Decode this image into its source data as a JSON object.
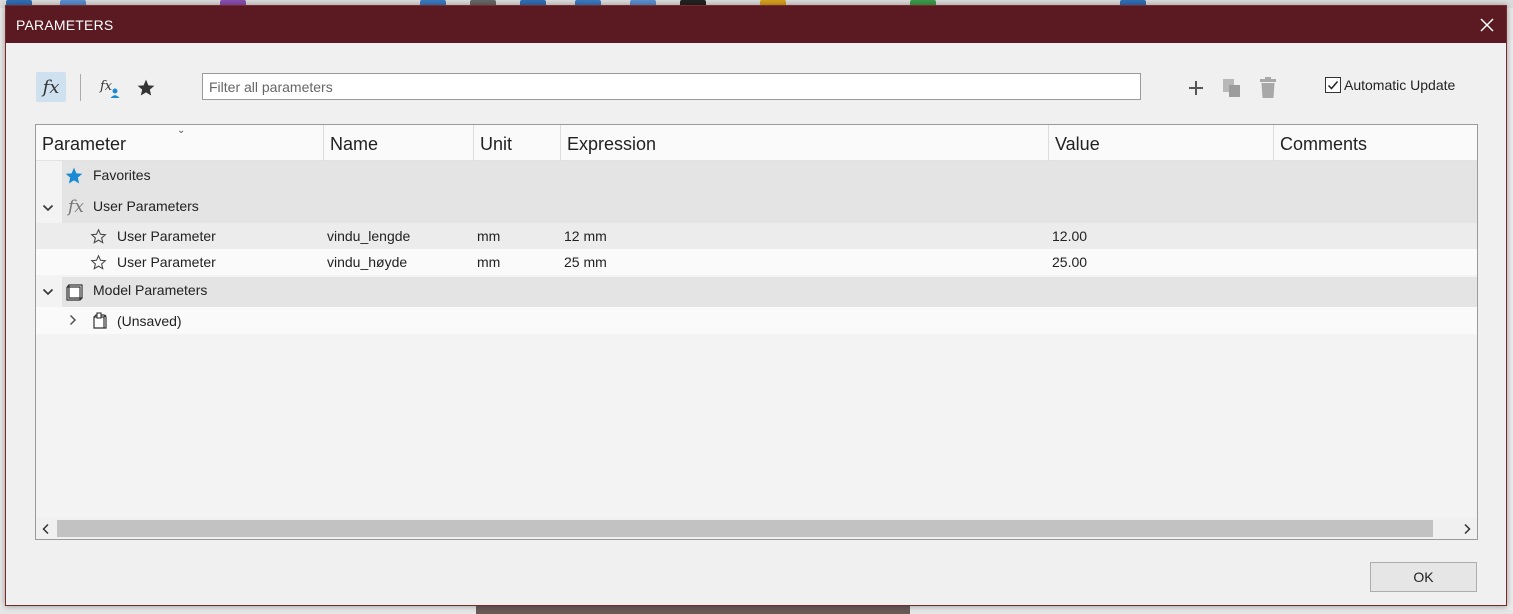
{
  "dialog": {
    "title": "PARAMETERS",
    "close_icon": "close-icon"
  },
  "toolbar": {
    "fx_icon": "fx",
    "filter_placeholder": "Filter all parameters",
    "filter_value": "",
    "auto_update_label": "Automatic Update",
    "auto_update_checked": true
  },
  "table": {
    "columns": [
      "Parameter",
      "Name",
      "Unit",
      "Expression",
      "Value",
      "Comments"
    ],
    "groups": {
      "favorites": {
        "label": "Favorites"
      },
      "user": {
        "label": "User Parameters",
        "rows": [
          {
            "parameter": "User Parameter",
            "name": "vindu_lengde",
            "unit": "mm",
            "expression": "12 mm",
            "value": "12.00",
            "comments": ""
          },
          {
            "parameter": "User Parameter",
            "name": "vindu_høyde",
            "unit": "mm",
            "expression": "25 mm",
            "value": "25.00",
            "comments": ""
          }
        ]
      },
      "model": {
        "label": "Model Parameters",
        "children": [
          {
            "label": "(Unsaved)"
          }
        ]
      }
    }
  },
  "footer": {
    "ok_label": "OK"
  },
  "colors": {
    "titlebar": "#5b1a22",
    "accent_star": "#1a8ad4",
    "fx_active_bg": "#cfe0ef"
  }
}
